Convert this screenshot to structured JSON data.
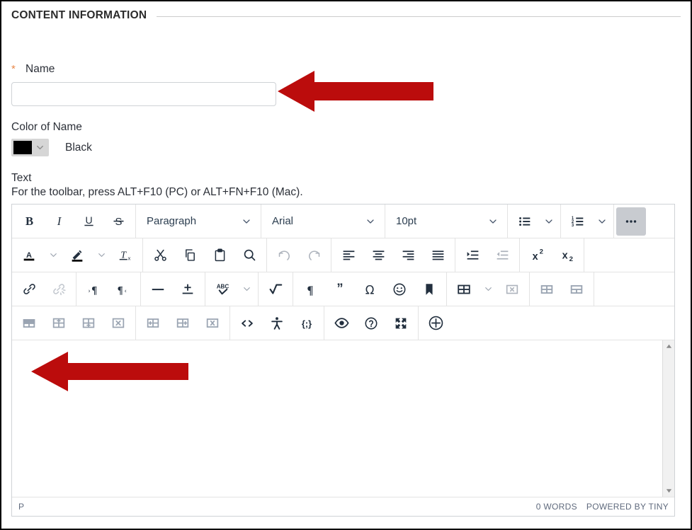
{
  "section": {
    "header_title": "CONTENT INFORMATION"
  },
  "form": {
    "name": {
      "label": "Name",
      "required_marker": "*",
      "value": "",
      "placeholder": ""
    },
    "color_of_name": {
      "label": "Color of Name",
      "selected_color_hex": "#000000",
      "selected_color_name": "Black"
    },
    "text": {
      "label": "Text",
      "hint": "For the toolbar, press ALT+F10 (PC) or ALT+FN+F10 (Mac)."
    }
  },
  "editor": {
    "toolbar": {
      "rows": [
        {
          "groups": [
            {
              "items": [
                {
                  "name": "bold-icon",
                  "label": "B"
                },
                {
                  "name": "italic-icon",
                  "label": "I"
                },
                {
                  "name": "underline-icon",
                  "label": "U"
                },
                {
                  "name": "strikethrough-icon",
                  "label": "S"
                }
              ]
            },
            {
              "items": [
                {
                  "name": "block-format-select",
                  "label": "Paragraph"
                }
              ]
            },
            {
              "items": [
                {
                  "name": "font-family-select",
                  "label": "Arial"
                }
              ]
            },
            {
              "items": [
                {
                  "name": "font-size-select",
                  "label": "10pt"
                }
              ]
            },
            {
              "items": [
                {
                  "name": "bullet-list-icon",
                  "label": ""
                }
              ]
            },
            {
              "items": [
                {
                  "name": "numbered-list-icon",
                  "label": ""
                }
              ]
            },
            {
              "items": [
                {
                  "name": "more-options-icon",
                  "label": ""
                }
              ]
            }
          ]
        },
        {
          "groups": [
            {
              "items": [
                {
                  "name": "text-color-icon",
                  "label": "A"
                },
                {
                  "name": "background-color-icon",
                  "label": ""
                },
                {
                  "name": "clear-formatting-icon",
                  "label": ""
                }
              ]
            },
            {
              "items": [
                {
                  "name": "cut-icon",
                  "label": ""
                },
                {
                  "name": "copy-icon",
                  "label": ""
                },
                {
                  "name": "paste-icon",
                  "label": ""
                },
                {
                  "name": "search-replace-icon",
                  "label": ""
                }
              ]
            },
            {
              "items": [
                {
                  "name": "undo-icon",
                  "label": ""
                },
                {
                  "name": "redo-icon",
                  "label": ""
                }
              ]
            },
            {
              "items": [
                {
                  "name": "align-left-icon",
                  "label": ""
                },
                {
                  "name": "align-center-icon",
                  "label": ""
                },
                {
                  "name": "align-right-icon",
                  "label": ""
                },
                {
                  "name": "align-justify-icon",
                  "label": ""
                }
              ]
            },
            {
              "items": [
                {
                  "name": "indent-increase-icon",
                  "label": ""
                },
                {
                  "name": "indent-decrease-icon",
                  "label": ""
                }
              ]
            },
            {
              "items": [
                {
                  "name": "superscript-icon",
                  "label": "x2"
                },
                {
                  "name": "subscript-icon",
                  "label": "x2"
                }
              ]
            }
          ]
        },
        {
          "groups": [
            {
              "items": [
                {
                  "name": "insert-link-icon",
                  "label": ""
                },
                {
                  "name": "remove-link-icon",
                  "label": ""
                }
              ]
            },
            {
              "items": [
                {
                  "name": "ltr-direction-icon",
                  "label": ""
                },
                {
                  "name": "rtl-direction-icon",
                  "label": ""
                }
              ]
            },
            {
              "items": [
                {
                  "name": "horizontal-rule-icon",
                  "label": ""
                },
                {
                  "name": "page-break-icon",
                  "label": ""
                }
              ]
            },
            {
              "items": [
                {
                  "name": "spellcheck-icon",
                  "label": "ABC"
                }
              ]
            },
            {
              "items": [
                {
                  "name": "math-equation-icon",
                  "label": ""
                }
              ]
            },
            {
              "items": [
                {
                  "name": "show-invisible-characters-icon",
                  "label": ""
                },
                {
                  "name": "blockquote-icon",
                  "label": ""
                },
                {
                  "name": "special-character-icon",
                  "label": ""
                },
                {
                  "name": "emoticons-icon",
                  "label": ""
                },
                {
                  "name": "anchor-icon",
                  "label": ""
                }
              ]
            },
            {
              "items": [
                {
                  "name": "insert-table-icon",
                  "label": ""
                },
                {
                  "name": "delete-table-icon",
                  "label": ""
                }
              ]
            },
            {
              "items": [
                {
                  "name": "table-properties-icon",
                  "label": ""
                },
                {
                  "name": "table-row-properties-icon",
                  "label": ""
                }
              ]
            }
          ]
        },
        {
          "groups": [
            {
              "items": [
                {
                  "name": "table-cell-properties-icon",
                  "label": ""
                },
                {
                  "name": "insert-row-above-icon",
                  "label": ""
                },
                {
                  "name": "insert-row-below-icon",
                  "label": ""
                },
                {
                  "name": "delete-row-icon",
                  "label": ""
                }
              ]
            },
            {
              "items": [
                {
                  "name": "insert-column-before-icon",
                  "label": ""
                },
                {
                  "name": "insert-column-after-icon",
                  "label": ""
                },
                {
                  "name": "delete-column-icon",
                  "label": ""
                }
              ]
            },
            {
              "items": [
                {
                  "name": "source-code-icon",
                  "label": ""
                },
                {
                  "name": "accessibility-checker-icon",
                  "label": ""
                },
                {
                  "name": "code-sample-icon",
                  "label": ""
                }
              ]
            },
            {
              "items": [
                {
                  "name": "preview-icon",
                  "label": ""
                },
                {
                  "name": "help-icon",
                  "label": ""
                },
                {
                  "name": "fullscreen-icon",
                  "label": ""
                }
              ]
            },
            {
              "items": [
                {
                  "name": "insert-media-icon",
                  "label": ""
                }
              ]
            }
          ]
        }
      ]
    },
    "content": {
      "value": ""
    },
    "statusbar": {
      "element_path": "P",
      "word_count": "0 WORDS",
      "branding": "POWERED BY TINY"
    }
  },
  "annotations": {
    "arrow_color": "#bb0c0c",
    "arrows": [
      {
        "name": "arrow-pointing-to-name-input",
        "points_to": "name-input"
      },
      {
        "name": "arrow-pointing-to-editor-body",
        "points_to": "editor-content-area"
      }
    ]
  }
}
